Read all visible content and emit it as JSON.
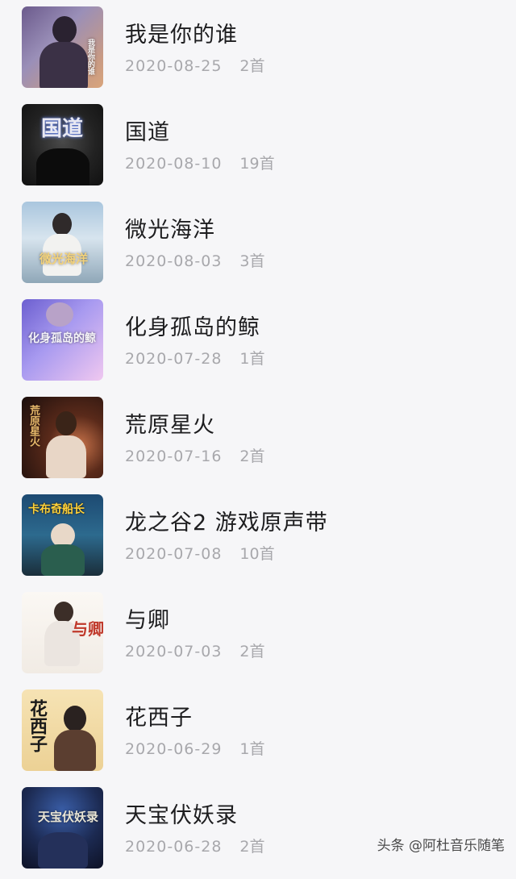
{
  "albums": [
    {
      "title": "我是你的谁",
      "date": "2020-08-25",
      "count": "2首",
      "cover_text": "我是你的谁"
    },
    {
      "title": "国道",
      "date": "2020-08-10",
      "count": "19首",
      "cover_text": "国道"
    },
    {
      "title": "微光海洋",
      "date": "2020-08-03",
      "count": "3首",
      "cover_text": "微光海洋"
    },
    {
      "title": "化身孤岛的鲸",
      "date": "2020-07-28",
      "count": "1首",
      "cover_text": "化身孤岛的鲸"
    },
    {
      "title": "荒原星火",
      "date": "2020-07-16",
      "count": "2首",
      "cover_text": "荒原星火"
    },
    {
      "title": "龙之谷2 游戏原声带",
      "date": "2020-07-08",
      "count": "10首",
      "cover_text": "卡布奇船长"
    },
    {
      "title": "与卿",
      "date": "2020-07-03",
      "count": "2首",
      "cover_text": "与卿"
    },
    {
      "title": "花西子",
      "date": "2020-06-29",
      "count": "1首",
      "cover_text": "花西子"
    },
    {
      "title": "天宝伏妖录",
      "date": "2020-06-28",
      "count": "2首",
      "cover_text": "天宝伏妖录"
    }
  ],
  "watermark": "头条 @阿杜音乐随笔",
  "colors": {
    "background": "#f6f6f8",
    "title_text": "#1d1d1f",
    "meta_text": "#a8a8ac"
  }
}
